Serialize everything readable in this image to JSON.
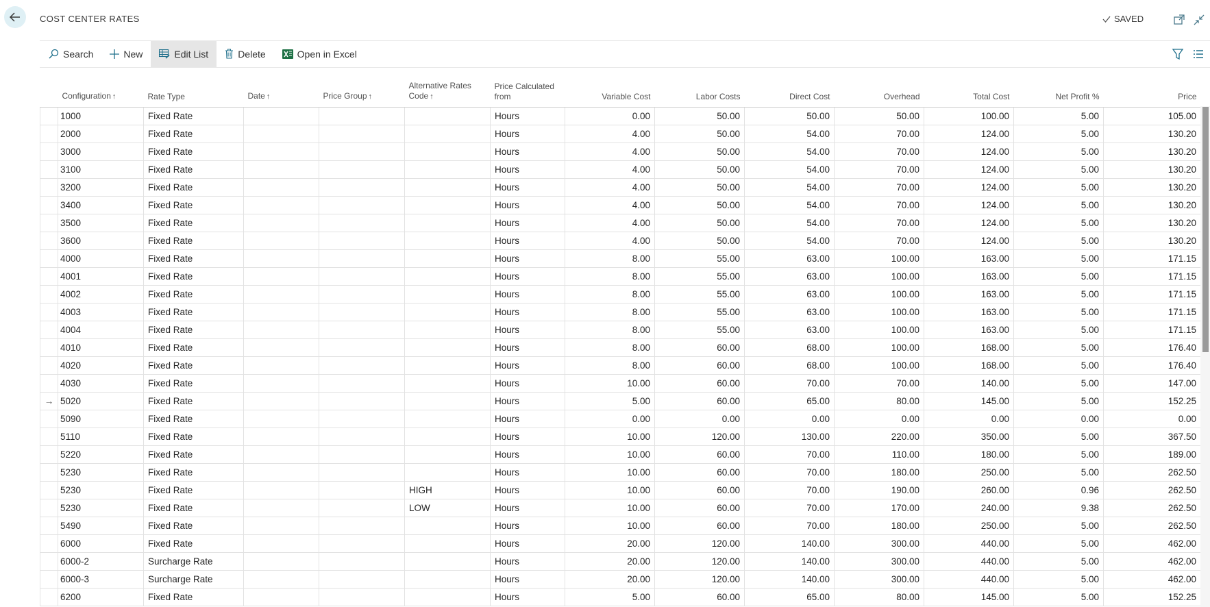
{
  "header": {
    "title": "COST CENTER RATES",
    "saved_label": "SAVED"
  },
  "toolbar": {
    "search_label": "Search",
    "new_label": "New",
    "edit_list_label": "Edit List",
    "delete_label": "Delete",
    "open_in_excel_label": "Open in Excel"
  },
  "icons": {
    "back": "back-arrow-icon",
    "saved": "checkmark-icon",
    "open_new_window": "open-new-window-icon",
    "collapse": "collapse-icon",
    "search": "search-icon",
    "new": "plus-icon",
    "edit_list": "edit-list-icon",
    "delete": "trash-icon",
    "excel": "excel-icon",
    "filter": "filter-icon",
    "list_view": "list-view-icon"
  },
  "colors": {
    "accent": "#dff0f5",
    "excel_green": "#1e7145",
    "active_button_bg": "#e6e6e6"
  },
  "table": {
    "columns": {
      "configuration": "Configuration",
      "rate_type": "Rate Type",
      "date": "Date",
      "price_group": "Price Group",
      "alt_rates_code_line1": "Alternative Rates",
      "alt_rates_code_line2": "Code",
      "price_calc_line1": "Price Calculated",
      "price_calc_line2": "from",
      "variable_cost": "Variable Cost",
      "labor_costs": "Labor Costs",
      "direct_cost": "Direct Cost",
      "overhead": "Overhead",
      "total_cost": "Total Cost",
      "net_profit": "Net Profit %",
      "price": "Price"
    },
    "sort_arrow": "↑",
    "current_row_marker": "→",
    "rows": [
      {
        "configuration": "1000",
        "rate_type": "Fixed Rate",
        "date": "",
        "price_group": "",
        "alt_code": "",
        "calc_from": "Hours",
        "variable_cost": "0.00",
        "labor_costs": "50.00",
        "direct_cost": "50.00",
        "overhead": "50.00",
        "total_cost": "100.00",
        "net_profit": "5.00",
        "price": "105.00",
        "marker": ""
      },
      {
        "configuration": "2000",
        "rate_type": "Fixed Rate",
        "date": "",
        "price_group": "",
        "alt_code": "",
        "calc_from": "Hours",
        "variable_cost": "4.00",
        "labor_costs": "50.00",
        "direct_cost": "54.00",
        "overhead": "70.00",
        "total_cost": "124.00",
        "net_profit": "5.00",
        "price": "130.20",
        "marker": ""
      },
      {
        "configuration": "3000",
        "rate_type": "Fixed Rate",
        "date": "",
        "price_group": "",
        "alt_code": "",
        "calc_from": "Hours",
        "variable_cost": "4.00",
        "labor_costs": "50.00",
        "direct_cost": "54.00",
        "overhead": "70.00",
        "total_cost": "124.00",
        "net_profit": "5.00",
        "price": "130.20",
        "marker": ""
      },
      {
        "configuration": "3100",
        "rate_type": "Fixed Rate",
        "date": "",
        "price_group": "",
        "alt_code": "",
        "calc_from": "Hours",
        "variable_cost": "4.00",
        "labor_costs": "50.00",
        "direct_cost": "54.00",
        "overhead": "70.00",
        "total_cost": "124.00",
        "net_profit": "5.00",
        "price": "130.20",
        "marker": ""
      },
      {
        "configuration": "3200",
        "rate_type": "Fixed Rate",
        "date": "",
        "price_group": "",
        "alt_code": "",
        "calc_from": "Hours",
        "variable_cost": "4.00",
        "labor_costs": "50.00",
        "direct_cost": "54.00",
        "overhead": "70.00",
        "total_cost": "124.00",
        "net_profit": "5.00",
        "price": "130.20",
        "marker": ""
      },
      {
        "configuration": "3400",
        "rate_type": "Fixed Rate",
        "date": "",
        "price_group": "",
        "alt_code": "",
        "calc_from": "Hours",
        "variable_cost": "4.00",
        "labor_costs": "50.00",
        "direct_cost": "54.00",
        "overhead": "70.00",
        "total_cost": "124.00",
        "net_profit": "5.00",
        "price": "130.20",
        "marker": ""
      },
      {
        "configuration": "3500",
        "rate_type": "Fixed Rate",
        "date": "",
        "price_group": "",
        "alt_code": "",
        "calc_from": "Hours",
        "variable_cost": "4.00",
        "labor_costs": "50.00",
        "direct_cost": "54.00",
        "overhead": "70.00",
        "total_cost": "124.00",
        "net_profit": "5.00",
        "price": "130.20",
        "marker": ""
      },
      {
        "configuration": "3600",
        "rate_type": "Fixed Rate",
        "date": "",
        "price_group": "",
        "alt_code": "",
        "calc_from": "Hours",
        "variable_cost": "4.00",
        "labor_costs": "50.00",
        "direct_cost": "54.00",
        "overhead": "70.00",
        "total_cost": "124.00",
        "net_profit": "5.00",
        "price": "130.20",
        "marker": ""
      },
      {
        "configuration": "4000",
        "rate_type": "Fixed Rate",
        "date": "",
        "price_group": "",
        "alt_code": "",
        "calc_from": "Hours",
        "variable_cost": "8.00",
        "labor_costs": "55.00",
        "direct_cost": "63.00",
        "overhead": "100.00",
        "total_cost": "163.00",
        "net_profit": "5.00",
        "price": "171.15",
        "marker": ""
      },
      {
        "configuration": "4001",
        "rate_type": "Fixed Rate",
        "date": "",
        "price_group": "",
        "alt_code": "",
        "calc_from": "Hours",
        "variable_cost": "8.00",
        "labor_costs": "55.00",
        "direct_cost": "63.00",
        "overhead": "100.00",
        "total_cost": "163.00",
        "net_profit": "5.00",
        "price": "171.15",
        "marker": ""
      },
      {
        "configuration": "4002",
        "rate_type": "Fixed Rate",
        "date": "",
        "price_group": "",
        "alt_code": "",
        "calc_from": "Hours",
        "variable_cost": "8.00",
        "labor_costs": "55.00",
        "direct_cost": "63.00",
        "overhead": "100.00",
        "total_cost": "163.00",
        "net_profit": "5.00",
        "price": "171.15",
        "marker": ""
      },
      {
        "configuration": "4003",
        "rate_type": "Fixed Rate",
        "date": "",
        "price_group": "",
        "alt_code": "",
        "calc_from": "Hours",
        "variable_cost": "8.00",
        "labor_costs": "55.00",
        "direct_cost": "63.00",
        "overhead": "100.00",
        "total_cost": "163.00",
        "net_profit": "5.00",
        "price": "171.15",
        "marker": ""
      },
      {
        "configuration": "4004",
        "rate_type": "Fixed Rate",
        "date": "",
        "price_group": "",
        "alt_code": "",
        "calc_from": "Hours",
        "variable_cost": "8.00",
        "labor_costs": "55.00",
        "direct_cost": "63.00",
        "overhead": "100.00",
        "total_cost": "163.00",
        "net_profit": "5.00",
        "price": "171.15",
        "marker": ""
      },
      {
        "configuration": "4010",
        "rate_type": "Fixed Rate",
        "date": "",
        "price_group": "",
        "alt_code": "",
        "calc_from": "Hours",
        "variable_cost": "8.00",
        "labor_costs": "60.00",
        "direct_cost": "68.00",
        "overhead": "100.00",
        "total_cost": "168.00",
        "net_profit": "5.00",
        "price": "176.40",
        "marker": ""
      },
      {
        "configuration": "4020",
        "rate_type": "Fixed Rate",
        "date": "",
        "price_group": "",
        "alt_code": "",
        "calc_from": "Hours",
        "variable_cost": "8.00",
        "labor_costs": "60.00",
        "direct_cost": "68.00",
        "overhead": "100.00",
        "total_cost": "168.00",
        "net_profit": "5.00",
        "price": "176.40",
        "marker": ""
      },
      {
        "configuration": "4030",
        "rate_type": "Fixed Rate",
        "date": "",
        "price_group": "",
        "alt_code": "",
        "calc_from": "Hours",
        "variable_cost": "10.00",
        "labor_costs": "60.00",
        "direct_cost": "70.00",
        "overhead": "70.00",
        "total_cost": "140.00",
        "net_profit": "5.00",
        "price": "147.00",
        "marker": ""
      },
      {
        "configuration": "5020",
        "rate_type": "Fixed Rate",
        "date": "",
        "price_group": "",
        "alt_code": "",
        "calc_from": "Hours",
        "variable_cost": "5.00",
        "labor_costs": "60.00",
        "direct_cost": "65.00",
        "overhead": "80.00",
        "total_cost": "145.00",
        "net_profit": "5.00",
        "price": "152.25",
        "marker": "→"
      },
      {
        "configuration": "5090",
        "rate_type": "Fixed Rate",
        "date": "",
        "price_group": "",
        "alt_code": "",
        "calc_from": "Hours",
        "variable_cost": "0.00",
        "labor_costs": "0.00",
        "direct_cost": "0.00",
        "overhead": "0.00",
        "total_cost": "0.00",
        "net_profit": "0.00",
        "price": "0.00",
        "marker": ""
      },
      {
        "configuration": "5110",
        "rate_type": "Fixed Rate",
        "date": "",
        "price_group": "",
        "alt_code": "",
        "calc_from": "Hours",
        "variable_cost": "10.00",
        "labor_costs": "120.00",
        "direct_cost": "130.00",
        "overhead": "220.00",
        "total_cost": "350.00",
        "net_profit": "5.00",
        "price": "367.50",
        "marker": ""
      },
      {
        "configuration": "5220",
        "rate_type": "Fixed Rate",
        "date": "",
        "price_group": "",
        "alt_code": "",
        "calc_from": "Hours",
        "variable_cost": "10.00",
        "labor_costs": "60.00",
        "direct_cost": "70.00",
        "overhead": "110.00",
        "total_cost": "180.00",
        "net_profit": "5.00",
        "price": "189.00",
        "marker": ""
      },
      {
        "configuration": "5230",
        "rate_type": "Fixed Rate",
        "date": "",
        "price_group": "",
        "alt_code": "",
        "calc_from": "Hours",
        "variable_cost": "10.00",
        "labor_costs": "60.00",
        "direct_cost": "70.00",
        "overhead": "180.00",
        "total_cost": "250.00",
        "net_profit": "5.00",
        "price": "262.50",
        "marker": ""
      },
      {
        "configuration": "5230",
        "rate_type": "Fixed Rate",
        "date": "",
        "price_group": "",
        "alt_code": "HIGH",
        "calc_from": "Hours",
        "variable_cost": "10.00",
        "labor_costs": "60.00",
        "direct_cost": "70.00",
        "overhead": "190.00",
        "total_cost": "260.00",
        "net_profit": "0.96",
        "price": "262.50",
        "marker": ""
      },
      {
        "configuration": "5230",
        "rate_type": "Fixed Rate",
        "date": "",
        "price_group": "",
        "alt_code": "LOW",
        "calc_from": "Hours",
        "variable_cost": "10.00",
        "labor_costs": "60.00",
        "direct_cost": "70.00",
        "overhead": "170.00",
        "total_cost": "240.00",
        "net_profit": "9.38",
        "price": "262.50",
        "marker": ""
      },
      {
        "configuration": "5490",
        "rate_type": "Fixed Rate",
        "date": "",
        "price_group": "",
        "alt_code": "",
        "calc_from": "Hours",
        "variable_cost": "10.00",
        "labor_costs": "60.00",
        "direct_cost": "70.00",
        "overhead": "180.00",
        "total_cost": "250.00",
        "net_profit": "5.00",
        "price": "262.50",
        "marker": ""
      },
      {
        "configuration": "6000",
        "rate_type": "Fixed Rate",
        "date": "",
        "price_group": "",
        "alt_code": "",
        "calc_from": "Hours",
        "variable_cost": "20.00",
        "labor_costs": "120.00",
        "direct_cost": "140.00",
        "overhead": "300.00",
        "total_cost": "440.00",
        "net_profit": "5.00",
        "price": "462.00",
        "marker": ""
      },
      {
        "configuration": "6000-2",
        "rate_type": "Surcharge Rate",
        "date": "",
        "price_group": "",
        "alt_code": "",
        "calc_from": "Hours",
        "variable_cost": "20.00",
        "labor_costs": "120.00",
        "direct_cost": "140.00",
        "overhead": "300.00",
        "total_cost": "440.00",
        "net_profit": "5.00",
        "price": "462.00",
        "marker": ""
      },
      {
        "configuration": "6000-3",
        "rate_type": "Surcharge Rate",
        "date": "",
        "price_group": "",
        "alt_code": "",
        "calc_from": "Hours",
        "variable_cost": "20.00",
        "labor_costs": "120.00",
        "direct_cost": "140.00",
        "overhead": "300.00",
        "total_cost": "440.00",
        "net_profit": "5.00",
        "price": "462.00",
        "marker": ""
      },
      {
        "configuration": "6200",
        "rate_type": "Fixed Rate",
        "date": "",
        "price_group": "",
        "alt_code": "",
        "calc_from": "Hours",
        "variable_cost": "5.00",
        "labor_costs": "60.00",
        "direct_cost": "65.00",
        "overhead": "80.00",
        "total_cost": "145.00",
        "net_profit": "5.00",
        "price": "152.25",
        "marker": ""
      }
    ]
  }
}
